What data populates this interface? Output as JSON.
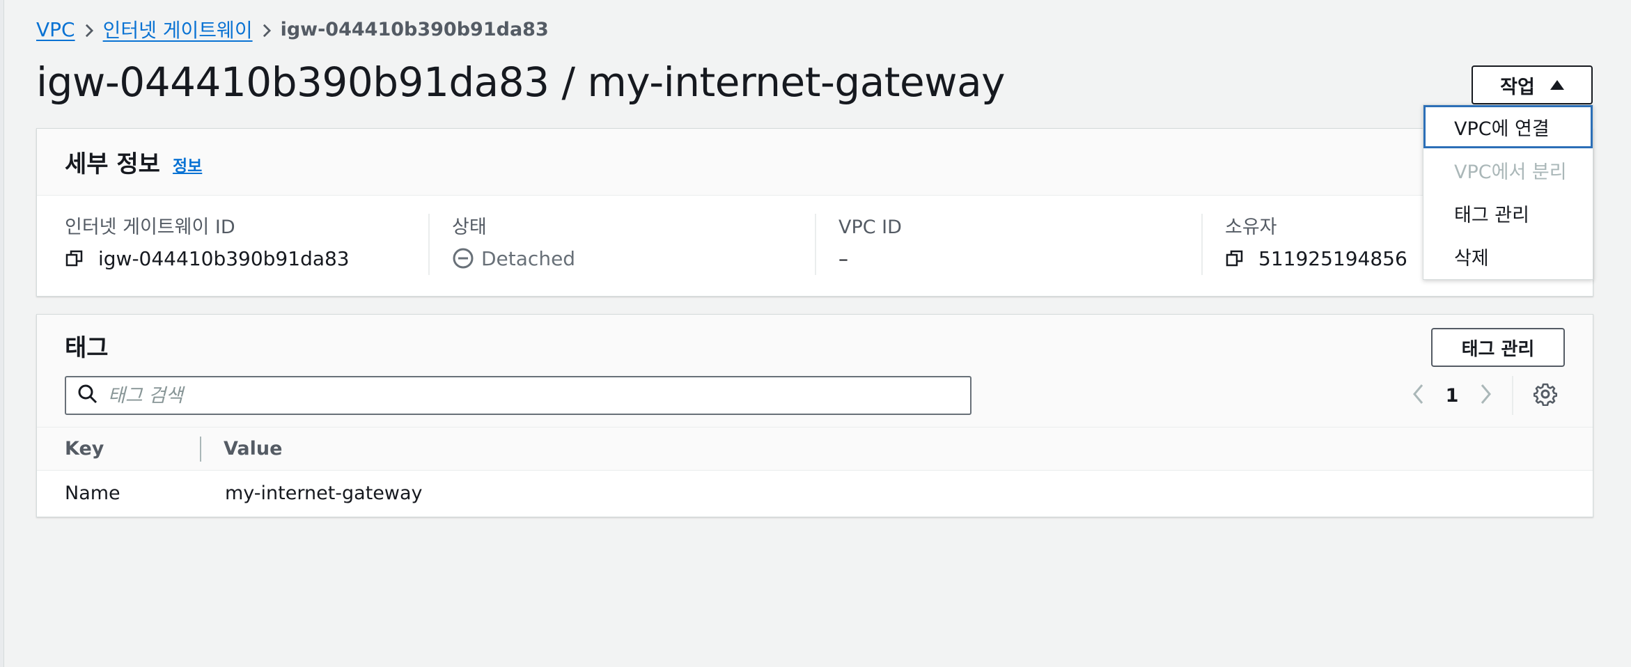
{
  "breadcrumb": {
    "items": [
      "VPC",
      "인터넷 게이트웨이"
    ],
    "current": "igw-044410b390b91da83"
  },
  "page_title": "igw-044410b390b91da83 / my-internet-gateway",
  "actions": {
    "label": "작업",
    "menu": [
      {
        "label": "VPC에 연결",
        "state": "focused"
      },
      {
        "label": "VPC에서 분리",
        "state": "disabled"
      },
      {
        "label": "태그 관리",
        "state": "enabled"
      },
      {
        "label": "삭제",
        "state": "enabled"
      }
    ]
  },
  "details": {
    "title": "세부 정보",
    "info_link": "정보",
    "fields": [
      {
        "label": "인터넷 게이트웨이 ID",
        "value": "igw-044410b390b91da83",
        "icon": "copy-icon"
      },
      {
        "label": "상태",
        "value": "Detached",
        "icon": "minus-circle-icon"
      },
      {
        "label": "VPC ID",
        "value": "–"
      },
      {
        "label": "소유자",
        "value": "511925194856",
        "icon": "copy-icon"
      }
    ]
  },
  "tags": {
    "title": "태그",
    "manage_button": "태그 관리",
    "search_placeholder": "태그 검색",
    "pagination": {
      "current_page": "1"
    },
    "columns": {
      "key": "Key",
      "value": "Value"
    },
    "rows": [
      {
        "key": "Name",
        "value": "my-internet-gateway"
      }
    ]
  },
  "colors": {
    "link": "#0972d3",
    "focus_border": "#2c6fb7",
    "disabled_text": "#aab7b8",
    "page_bg": "#f2f3f3"
  }
}
